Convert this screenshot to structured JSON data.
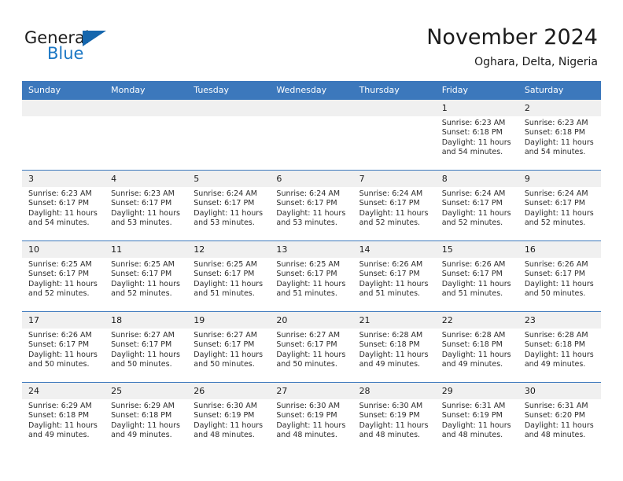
{
  "brand": {
    "name_part1": "General",
    "name_part2": "Blue",
    "triangle_color": "#1566ad",
    "blue_color": "#1b77c4"
  },
  "header": {
    "title": "November 2024",
    "subtitle": "Oghara, Delta, Nigeria"
  },
  "colors": {
    "header_row_bg": "#3c78bc",
    "daynum_bg": "#f0f0f0",
    "grid_line": "#3c78bc",
    "text": "#1b1b1b"
  },
  "weekday_headers": [
    "Sunday",
    "Monday",
    "Tuesday",
    "Wednesday",
    "Thursday",
    "Friday",
    "Saturday"
  ],
  "weeks": [
    [
      {
        "day": "",
        "sunrise": "",
        "sunset": "",
        "daylight_line1": "",
        "daylight_line2": ""
      },
      {
        "day": "",
        "sunrise": "",
        "sunset": "",
        "daylight_line1": "",
        "daylight_line2": ""
      },
      {
        "day": "",
        "sunrise": "",
        "sunset": "",
        "daylight_line1": "",
        "daylight_line2": ""
      },
      {
        "day": "",
        "sunrise": "",
        "sunset": "",
        "daylight_line1": "",
        "daylight_line2": ""
      },
      {
        "day": "",
        "sunrise": "",
        "sunset": "",
        "daylight_line1": "",
        "daylight_line2": ""
      },
      {
        "day": "1",
        "sunrise": "Sunrise: 6:23 AM",
        "sunset": "Sunset: 6:18 PM",
        "daylight_line1": "Daylight: 11 hours",
        "daylight_line2": "and 54 minutes."
      },
      {
        "day": "2",
        "sunrise": "Sunrise: 6:23 AM",
        "sunset": "Sunset: 6:18 PM",
        "daylight_line1": "Daylight: 11 hours",
        "daylight_line2": "and 54 minutes."
      }
    ],
    [
      {
        "day": "3",
        "sunrise": "Sunrise: 6:23 AM",
        "sunset": "Sunset: 6:17 PM",
        "daylight_line1": "Daylight: 11 hours",
        "daylight_line2": "and 54 minutes."
      },
      {
        "day": "4",
        "sunrise": "Sunrise: 6:23 AM",
        "sunset": "Sunset: 6:17 PM",
        "daylight_line1": "Daylight: 11 hours",
        "daylight_line2": "and 53 minutes."
      },
      {
        "day": "5",
        "sunrise": "Sunrise: 6:24 AM",
        "sunset": "Sunset: 6:17 PM",
        "daylight_line1": "Daylight: 11 hours",
        "daylight_line2": "and 53 minutes."
      },
      {
        "day": "6",
        "sunrise": "Sunrise: 6:24 AM",
        "sunset": "Sunset: 6:17 PM",
        "daylight_line1": "Daylight: 11 hours",
        "daylight_line2": "and 53 minutes."
      },
      {
        "day": "7",
        "sunrise": "Sunrise: 6:24 AM",
        "sunset": "Sunset: 6:17 PM",
        "daylight_line1": "Daylight: 11 hours",
        "daylight_line2": "and 52 minutes."
      },
      {
        "day": "8",
        "sunrise": "Sunrise: 6:24 AM",
        "sunset": "Sunset: 6:17 PM",
        "daylight_line1": "Daylight: 11 hours",
        "daylight_line2": "and 52 minutes."
      },
      {
        "day": "9",
        "sunrise": "Sunrise: 6:24 AM",
        "sunset": "Sunset: 6:17 PM",
        "daylight_line1": "Daylight: 11 hours",
        "daylight_line2": "and 52 minutes."
      }
    ],
    [
      {
        "day": "10",
        "sunrise": "Sunrise: 6:25 AM",
        "sunset": "Sunset: 6:17 PM",
        "daylight_line1": "Daylight: 11 hours",
        "daylight_line2": "and 52 minutes."
      },
      {
        "day": "11",
        "sunrise": "Sunrise: 6:25 AM",
        "sunset": "Sunset: 6:17 PM",
        "daylight_line1": "Daylight: 11 hours",
        "daylight_line2": "and 52 minutes."
      },
      {
        "day": "12",
        "sunrise": "Sunrise: 6:25 AM",
        "sunset": "Sunset: 6:17 PM",
        "daylight_line1": "Daylight: 11 hours",
        "daylight_line2": "and 51 minutes."
      },
      {
        "day": "13",
        "sunrise": "Sunrise: 6:25 AM",
        "sunset": "Sunset: 6:17 PM",
        "daylight_line1": "Daylight: 11 hours",
        "daylight_line2": "and 51 minutes."
      },
      {
        "day": "14",
        "sunrise": "Sunrise: 6:26 AM",
        "sunset": "Sunset: 6:17 PM",
        "daylight_line1": "Daylight: 11 hours",
        "daylight_line2": "and 51 minutes."
      },
      {
        "day": "15",
        "sunrise": "Sunrise: 6:26 AM",
        "sunset": "Sunset: 6:17 PM",
        "daylight_line1": "Daylight: 11 hours",
        "daylight_line2": "and 51 minutes."
      },
      {
        "day": "16",
        "sunrise": "Sunrise: 6:26 AM",
        "sunset": "Sunset: 6:17 PM",
        "daylight_line1": "Daylight: 11 hours",
        "daylight_line2": "and 50 minutes."
      }
    ],
    [
      {
        "day": "17",
        "sunrise": "Sunrise: 6:26 AM",
        "sunset": "Sunset: 6:17 PM",
        "daylight_line1": "Daylight: 11 hours",
        "daylight_line2": "and 50 minutes."
      },
      {
        "day": "18",
        "sunrise": "Sunrise: 6:27 AM",
        "sunset": "Sunset: 6:17 PM",
        "daylight_line1": "Daylight: 11 hours",
        "daylight_line2": "and 50 minutes."
      },
      {
        "day": "19",
        "sunrise": "Sunrise: 6:27 AM",
        "sunset": "Sunset: 6:17 PM",
        "daylight_line1": "Daylight: 11 hours",
        "daylight_line2": "and 50 minutes."
      },
      {
        "day": "20",
        "sunrise": "Sunrise: 6:27 AM",
        "sunset": "Sunset: 6:17 PM",
        "daylight_line1": "Daylight: 11 hours",
        "daylight_line2": "and 50 minutes."
      },
      {
        "day": "21",
        "sunrise": "Sunrise: 6:28 AM",
        "sunset": "Sunset: 6:18 PM",
        "daylight_line1": "Daylight: 11 hours",
        "daylight_line2": "and 49 minutes."
      },
      {
        "day": "22",
        "sunrise": "Sunrise: 6:28 AM",
        "sunset": "Sunset: 6:18 PM",
        "daylight_line1": "Daylight: 11 hours",
        "daylight_line2": "and 49 minutes."
      },
      {
        "day": "23",
        "sunrise": "Sunrise: 6:28 AM",
        "sunset": "Sunset: 6:18 PM",
        "daylight_line1": "Daylight: 11 hours",
        "daylight_line2": "and 49 minutes."
      }
    ],
    [
      {
        "day": "24",
        "sunrise": "Sunrise: 6:29 AM",
        "sunset": "Sunset: 6:18 PM",
        "daylight_line1": "Daylight: 11 hours",
        "daylight_line2": "and 49 minutes."
      },
      {
        "day": "25",
        "sunrise": "Sunrise: 6:29 AM",
        "sunset": "Sunset: 6:18 PM",
        "daylight_line1": "Daylight: 11 hours",
        "daylight_line2": "and 49 minutes."
      },
      {
        "day": "26",
        "sunrise": "Sunrise: 6:30 AM",
        "sunset": "Sunset: 6:19 PM",
        "daylight_line1": "Daylight: 11 hours",
        "daylight_line2": "and 48 minutes."
      },
      {
        "day": "27",
        "sunrise": "Sunrise: 6:30 AM",
        "sunset": "Sunset: 6:19 PM",
        "daylight_line1": "Daylight: 11 hours",
        "daylight_line2": "and 48 minutes."
      },
      {
        "day": "28",
        "sunrise": "Sunrise: 6:30 AM",
        "sunset": "Sunset: 6:19 PM",
        "daylight_line1": "Daylight: 11 hours",
        "daylight_line2": "and 48 minutes."
      },
      {
        "day": "29",
        "sunrise": "Sunrise: 6:31 AM",
        "sunset": "Sunset: 6:19 PM",
        "daylight_line1": "Daylight: 11 hours",
        "daylight_line2": "and 48 minutes."
      },
      {
        "day": "30",
        "sunrise": "Sunrise: 6:31 AM",
        "sunset": "Sunset: 6:20 PM",
        "daylight_line1": "Daylight: 11 hours",
        "daylight_line2": "and 48 minutes."
      }
    ]
  ]
}
